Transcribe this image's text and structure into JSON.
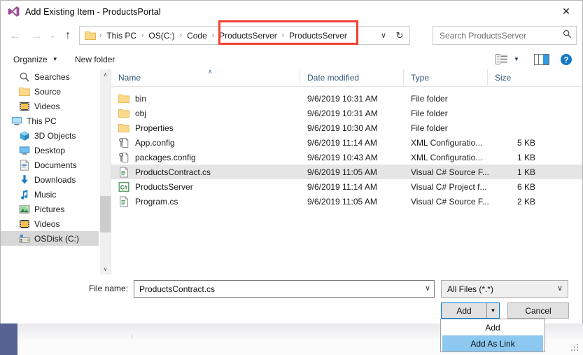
{
  "window": {
    "title": "Add Existing Item - ProductsPortal",
    "app_icon": "visual-studio-icon",
    "close_label": "✕"
  },
  "navbar": {
    "back_icon": "←",
    "forward_icon": "→",
    "recent_icon": "⌄",
    "up_icon": "↑",
    "refresh_icon": "↻",
    "dropdown_icon": "∨",
    "breadcrumbs": [
      "This PC",
      "OS(C:)",
      "Code",
      "ProductsServer",
      "ProductsServer"
    ],
    "separator": "›"
  },
  "search": {
    "placeholder": "Search ProductsServer",
    "icon": "search-icon"
  },
  "commandbar": {
    "organize_label": "Organize",
    "organize_caret": "▼",
    "new_folder_label": "New folder",
    "view_icon": "view-list-icon",
    "view_caret": "▼",
    "preview_pane_icon": "preview-pane-icon",
    "help_icon": "?"
  },
  "navigation_pane": {
    "items": [
      {
        "label": "Searches",
        "icon": "search-folder-icon",
        "indent": 26,
        "selected": false
      },
      {
        "label": "Source",
        "icon": "folder-icon",
        "indent": 26,
        "selected": false
      },
      {
        "label": "Videos",
        "icon": "videos-icon",
        "indent": 26,
        "selected": false
      },
      {
        "label": "This PC",
        "icon": "this-pc-icon",
        "indent": 15,
        "selected": false
      },
      {
        "label": "3D Objects",
        "icon": "3d-objects-icon",
        "indent": 26,
        "selected": false
      },
      {
        "label": "Desktop",
        "icon": "desktop-icon",
        "indent": 26,
        "selected": false
      },
      {
        "label": "Documents",
        "icon": "documents-icon",
        "indent": 26,
        "selected": false
      },
      {
        "label": "Downloads",
        "icon": "downloads-icon",
        "indent": 26,
        "selected": false
      },
      {
        "label": "Music",
        "icon": "music-icon",
        "indent": 26,
        "selected": false
      },
      {
        "label": "Pictures",
        "icon": "pictures-icon",
        "indent": 26,
        "selected": false
      },
      {
        "label": "Videos",
        "icon": "videos-icon",
        "indent": 26,
        "selected": false
      },
      {
        "label": "OSDisk (C:)",
        "icon": "disk-icon",
        "indent": 26,
        "selected": true
      }
    ],
    "scroll_up_icon": "∧",
    "scroll_down_icon": "∨"
  },
  "filelist": {
    "sort_indicator": "∧",
    "columns": [
      "Name",
      "Date modified",
      "Type",
      "Size"
    ],
    "rows": [
      {
        "name": "bin",
        "date": "9/6/2019 10:31 AM",
        "type": "File folder",
        "size": "",
        "icon": "folder-icon",
        "selected": false
      },
      {
        "name": "obj",
        "date": "9/6/2019 10:31 AM",
        "type": "File folder",
        "size": "",
        "icon": "folder-icon",
        "selected": false
      },
      {
        "name": "Properties",
        "date": "9/6/2019 10:30 AM",
        "type": "File folder",
        "size": "",
        "icon": "folder-icon",
        "selected": false
      },
      {
        "name": "App.config",
        "date": "9/6/2019 11:14 AM",
        "type": "XML Configuratio...",
        "size": "5 KB",
        "icon": "xml-config-icon",
        "selected": false
      },
      {
        "name": "packages.config",
        "date": "9/6/2019 10:43 AM",
        "type": "XML Configuratio...",
        "size": "1 KB",
        "icon": "xml-config-icon",
        "selected": false
      },
      {
        "name": "ProductsContract.cs",
        "date": "9/6/2019 11:05 AM",
        "type": "Visual C# Source F...",
        "size": "1 KB",
        "icon": "cs-source-icon",
        "selected": true
      },
      {
        "name": "ProductsServer",
        "date": "9/6/2019 11:14 AM",
        "type": "Visual C# Project f...",
        "size": "6 KB",
        "icon": "csproj-icon",
        "selected": false
      },
      {
        "name": "Program.cs",
        "date": "9/6/2019 11:05 AM",
        "type": "Visual C# Source F...",
        "size": "2 KB",
        "icon": "cs-source-icon",
        "selected": false
      }
    ]
  },
  "form": {
    "filename_label": "File name:",
    "filename_value": "ProductsContract.cs",
    "filename_chevron": "∨",
    "filter_value": "All Files (*.*)",
    "filter_chevron": "∨",
    "add_button_label": "Add",
    "add_split_arrow": "▼",
    "cancel_button_label": "Cancel"
  },
  "dropdown_menu": {
    "items": [
      {
        "label": "Add",
        "highlighted": false
      },
      {
        "label": "Add As Link",
        "highlighted": true
      }
    ]
  },
  "highlights": {
    "accent_red": "#f43f33",
    "selection_blue": "#8cc8f0",
    "focus_blue": "#0078d7"
  }
}
